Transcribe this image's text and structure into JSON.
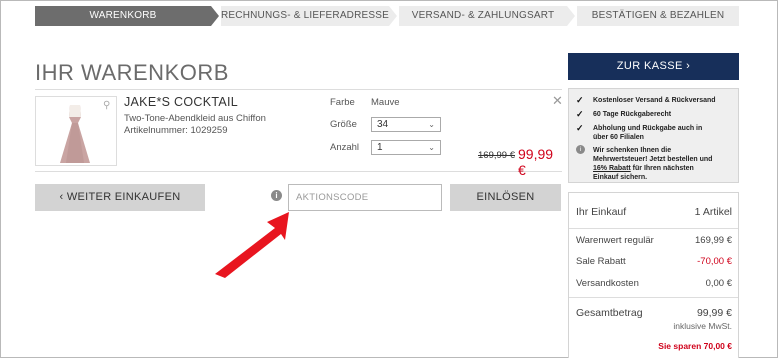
{
  "steps": [
    {
      "label": "WARENKORB",
      "active": true
    },
    {
      "label": "RECHNUNGS- & LIEFERADRESSE",
      "active": false
    },
    {
      "label": "VERSAND- & ZAHLUNGSART",
      "active": false
    },
    {
      "label": "BESTÄTIGEN & BEZAHLEN",
      "active": false
    }
  ],
  "page_title": "IHR WARENKORB",
  "item": {
    "name": "JAKE*S COCKTAIL",
    "description": "Two-Tone-Abendkleid aus Chiffon",
    "article": "Artikelnummer: 1029259",
    "color_label": "Farbe",
    "color_value": "Mauve",
    "size_label": "Größe",
    "size_value": "34",
    "qty_label": "Anzahl",
    "qty_value": "1",
    "old_price": "169,99 €",
    "new_price": "99,99 €"
  },
  "actions": {
    "continue_label": "WEITER EINKAUFEN",
    "code_placeholder": "AKTIONSCODE",
    "redeem_label": "EINLÖSEN"
  },
  "checkout": {
    "button_label": "ZUR KASSE"
  },
  "usps": [
    "Kostenloser Versand & Rückversand",
    "60 Tage Rückgaberecht",
    "Abholung und Rückgabe auch in über 60 Filialen"
  ],
  "vat_note": {
    "pre": "Wir schenken Ihnen die Mehrwertsteuer! Jetzt bestellen und ",
    "highlight": "16% Rabatt",
    "post": " für Ihren nächsten Einkauf sichern."
  },
  "summary": {
    "title": "Ihr Einkauf",
    "count": "1 Artikel",
    "rows": [
      {
        "label": "Warenwert regulär",
        "value": "169,99 €"
      },
      {
        "label": "Sale Rabatt",
        "value": "-70,00 €"
      },
      {
        "label": "Versandkosten",
        "value": "0,00 €"
      }
    ],
    "total_label": "Gesamtbetrag",
    "total_value": "99,99 €",
    "vat": "inklusive MwSt.",
    "savings": "Sie sparen 70,00 €"
  },
  "colors": {
    "accent_navy": "#172f5a",
    "price_red": "#d0021b",
    "arrow_red": "#e8151f"
  }
}
